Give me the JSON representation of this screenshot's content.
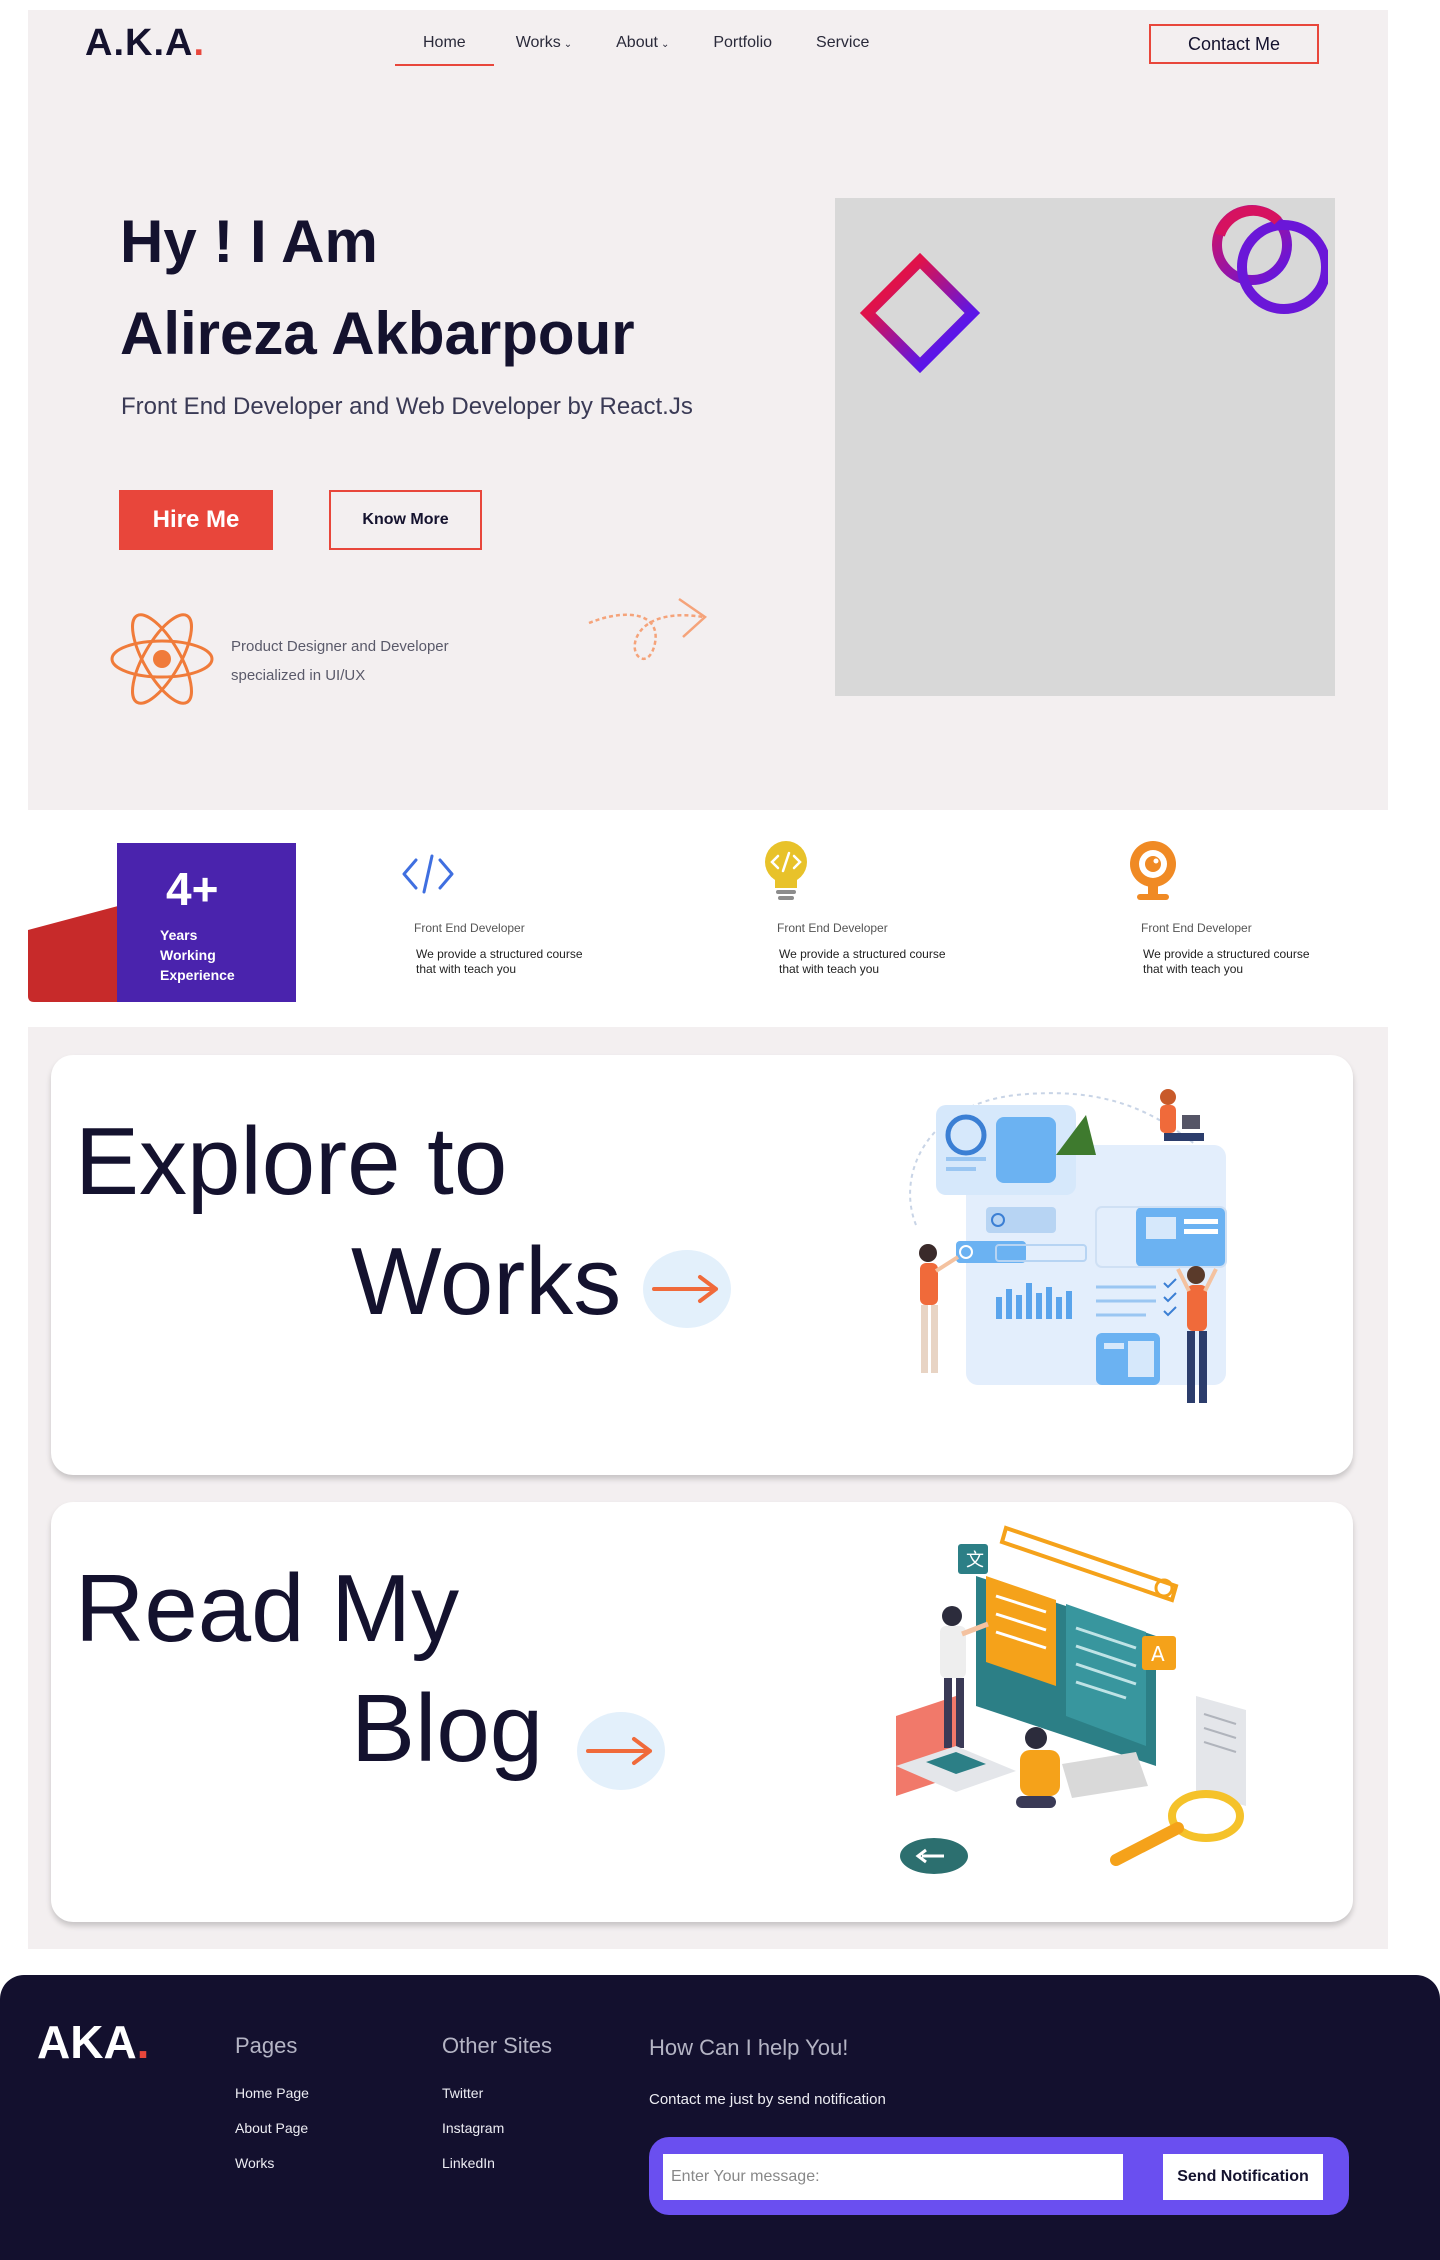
{
  "header": {
    "logo_text": "A.K.A",
    "logo_dot": ".",
    "nav": [
      {
        "label": "Home",
        "has_caret": false
      },
      {
        "label": "Works",
        "has_caret": true
      },
      {
        "label": "About",
        "has_caret": true
      },
      {
        "label": "Portfolio",
        "has_caret": false
      },
      {
        "label": "Service",
        "has_caret": false
      }
    ],
    "caret": "⌄",
    "contact_label": "Contact Me"
  },
  "hero": {
    "title_line1": "Hy ! I Am",
    "title_line2": "Alireza Akbarpour",
    "subtitle": "Front End Developer and Web Developer by React.Js",
    "hire_label": "Hire Me",
    "know_label": "Know More",
    "note_line1": "Product Designer and Developer",
    "note_line2": "specialized in UI/UX"
  },
  "experience": {
    "number": "4+",
    "label_line1": "Years",
    "label_line2": "Working",
    "label_line3": "Experience"
  },
  "skills": [
    {
      "icon": "code-icon",
      "title": "Front End Developer",
      "desc_line1": "We provide a structured course",
      "desc_line2": "that with teach you"
    },
    {
      "icon": "lightbulb-code-icon",
      "title": "Front End Developer",
      "desc_line1": "We provide a structured course",
      "desc_line2": "that with teach you"
    },
    {
      "icon": "webcam-icon",
      "title": "Front End Developer",
      "desc_line1": "We provide a structured course",
      "desc_line2": "that with teach you"
    }
  ],
  "cards": {
    "works_line1": "Explore to",
    "works_line2": "Works",
    "blog_line1": "Read My",
    "blog_line2": "Blog"
  },
  "footer": {
    "logo_text": "AKA",
    "logo_dot": ".",
    "pages_head": "Pages",
    "pages": [
      "Home Page",
      "About Page",
      "Works"
    ],
    "other_head": "Other Sites",
    "other": [
      "Twitter",
      "Instagram",
      "LinkedIn"
    ],
    "help_head": "How Can I help You!",
    "help_sub": "Contact me just by send notification",
    "input_placeholder": "Enter Your message:",
    "send_label": "Send Notification"
  },
  "colors": {
    "accent": "#e8463b",
    "navy": "#14122e",
    "purple": "#4a23ad",
    "violet": "#6a4ff0",
    "hero_bg": "#f3eff0"
  }
}
